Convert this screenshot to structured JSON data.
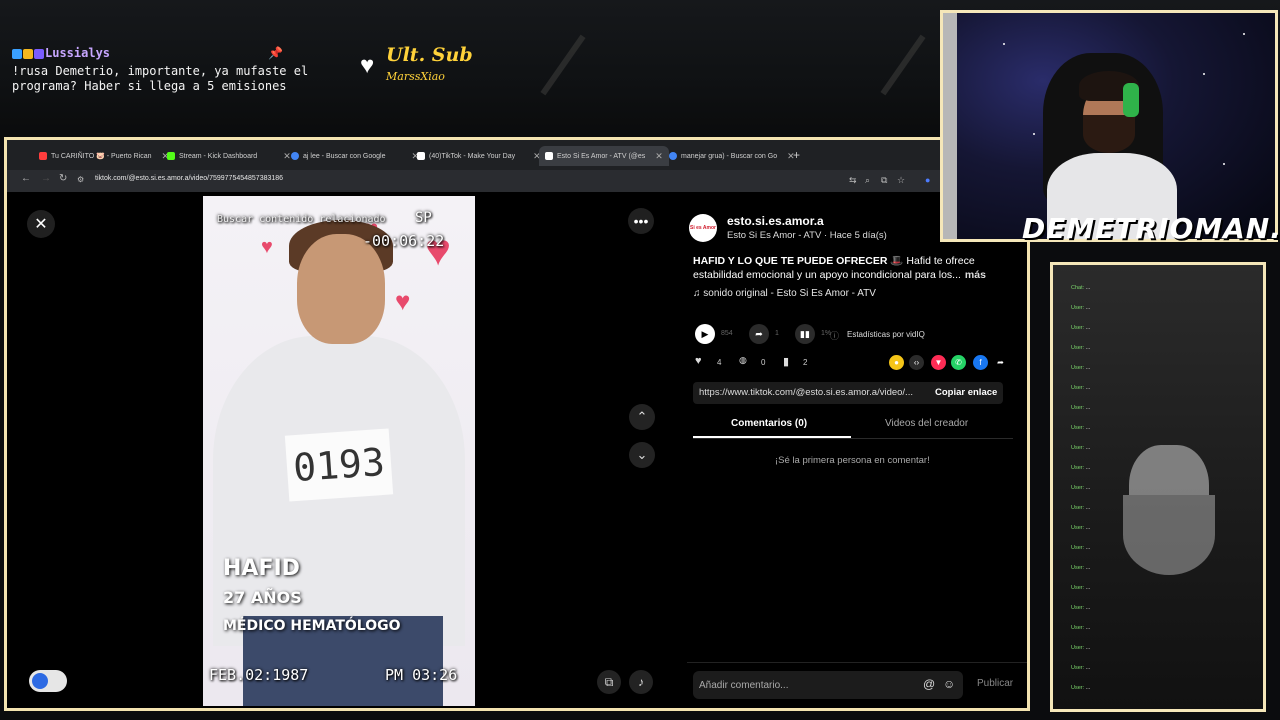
{
  "overlay": {
    "chat_user": "Lussialys",
    "chat_message": "!rusa Demetrio, importante, ya mufaste el programa? Haber si llega a 5 emisiones",
    "ult_sub_title": "Ult. Sub",
    "ult_sub_name": "MarssXiao",
    "streamer_name": "DEMETRIOMAN..."
  },
  "browser": {
    "tabs": [
      {
        "label": "Tu CARIÑITO 🐷 - Puerto Rican",
        "color": "#ff3d3d"
      },
      {
        "label": "Stream - Kick Dashboard",
        "color": "#53fc18"
      },
      {
        "label": "aj lee - Buscar con Google",
        "color": "#4285f4"
      },
      {
        "label": "(40)TikTok - Make Your Day",
        "color": "#ffffff"
      },
      {
        "label": "Esto Si Es Amor - ATV (@es",
        "color": "#ffffff",
        "active": true
      },
      {
        "label": "manejar grua) - Buscar con Go",
        "color": "#4285f4"
      }
    ],
    "url": "tiktok.com/@esto.si.es.amor.a/video/7599775454857383186"
  },
  "video": {
    "related_label": "Buscar contenido relacionado",
    "timer": "-00:06:22",
    "sp_label": "SP",
    "number_card": "0193",
    "name": "HAFID",
    "age": "27 AÑOS",
    "job": "MÉDICO HEMATÓLOGO",
    "date_left": "FEB.02:1987",
    "date_right": "PM 03:26"
  },
  "post": {
    "avatar_text": "Si es Amor",
    "account": "esto.si.es.amor.a",
    "subtitle": "Esto Si Es Amor - ATV · Hace 5 día(s)",
    "description_bold": "HAFID Y LO QUE TE PUEDE OFRECER",
    "description": "Hafid te ofrece estabilidad emocional y un apoyo incondicional para los...",
    "more": "más",
    "sound": "sonido original - Esto Si Es Amor - ATV",
    "plays": "854",
    "shares_small": "1",
    "stats_pct": "1%",
    "stats_label": "Estadísticas por vidIQ",
    "likes": "4",
    "comments": "0",
    "saves": "2",
    "link": "https://www.tiktok.com/@esto.si.es.amor.a/video/...",
    "copy_link": "Copiar enlace",
    "tab_comments": "Comentarios (0)",
    "tab_creator": "Videos del creador",
    "empty": "¡Sé la primera persona en comentar!",
    "comment_placeholder": "Añadir comentario...",
    "publish": "Publicar"
  },
  "icons": {
    "close": "✕",
    "more": "•••",
    "up": "⌃",
    "down": "⌄",
    "volume": "🔊",
    "play": "▶",
    "share": "➦",
    "heart": "♥",
    "comment": "💬",
    "bookmark": "🔖",
    "at": "@",
    "emoji": "☺",
    "music": "♫"
  },
  "colors": {
    "accent": "#fe2c55",
    "frame": "#f3e3b0",
    "chat_user": "#c7a6ff",
    "ult_sub": "#ffd23a"
  }
}
